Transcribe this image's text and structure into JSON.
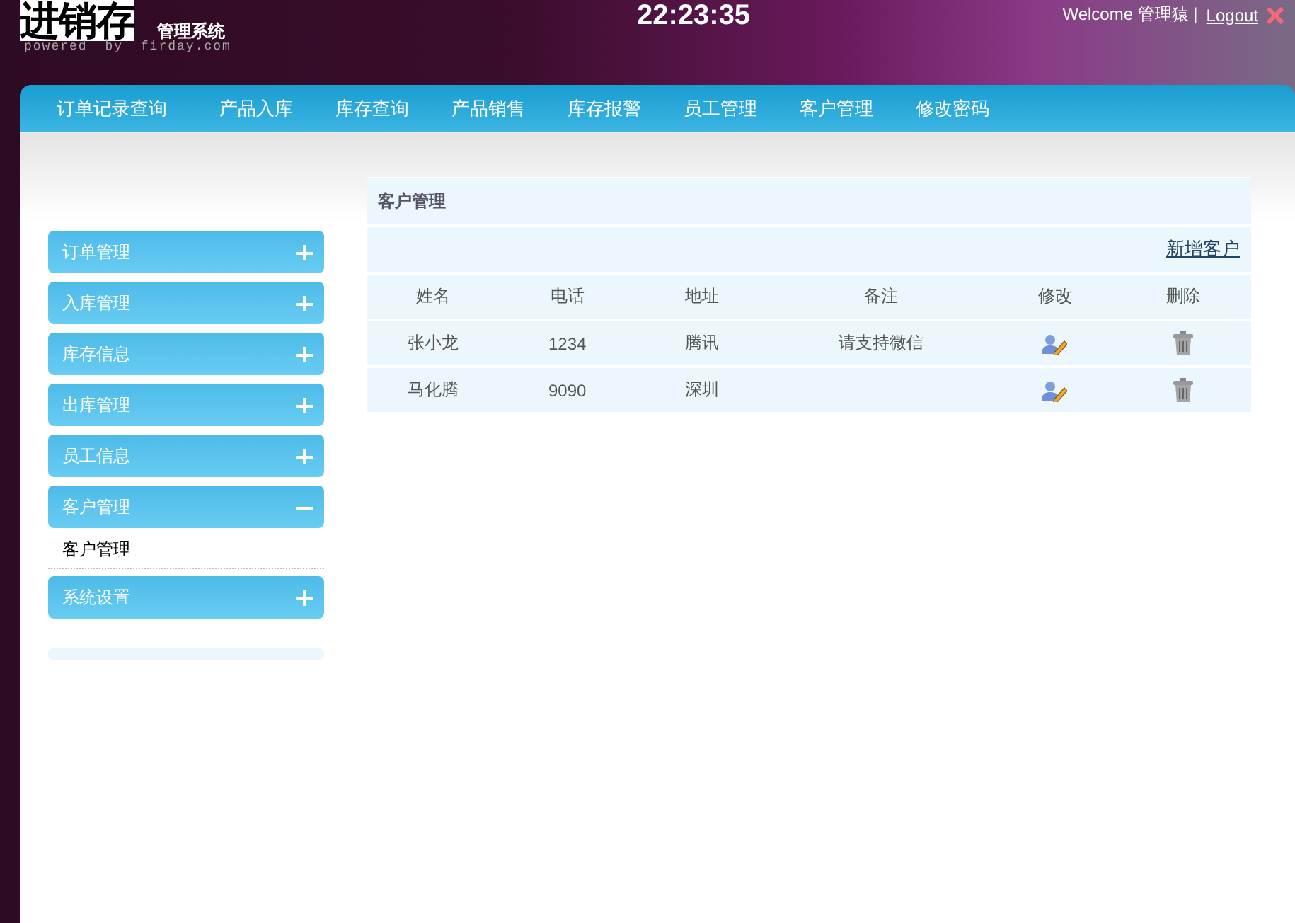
{
  "header": {
    "logo": "进销存",
    "subtitle": "管理系统",
    "powered": "powered by firday.com",
    "clock": "22:23:35",
    "welcome": "Welcome 管理猿 |",
    "logout": "Logout"
  },
  "nav": [
    "订单记录查询",
    "产品入库",
    "库存查询",
    "产品销售",
    "库存报警",
    "员工管理",
    "客户管理",
    "修改密码"
  ],
  "sidebar": [
    {
      "label": "订单管理",
      "expanded": false
    },
    {
      "label": "入库管理",
      "expanded": false
    },
    {
      "label": "库存信息",
      "expanded": false
    },
    {
      "label": "出库管理",
      "expanded": false
    },
    {
      "label": "员工信息",
      "expanded": false
    },
    {
      "label": "客户管理",
      "expanded": true,
      "children": [
        {
          "label": "客户管理"
        }
      ]
    },
    {
      "label": "系统设置",
      "expanded": false
    }
  ],
  "panel": {
    "title": "客户管理",
    "add_link": "新增客户",
    "columns": [
      "姓名",
      "电话",
      "地址",
      "备注",
      "修改",
      "删除"
    ],
    "rows": [
      {
        "name": "张小龙",
        "phone": "1234",
        "address": "腾讯",
        "note": "请支持微信"
      },
      {
        "name": "马化腾",
        "phone": "9090",
        "address": "深圳"
      }
    ]
  }
}
